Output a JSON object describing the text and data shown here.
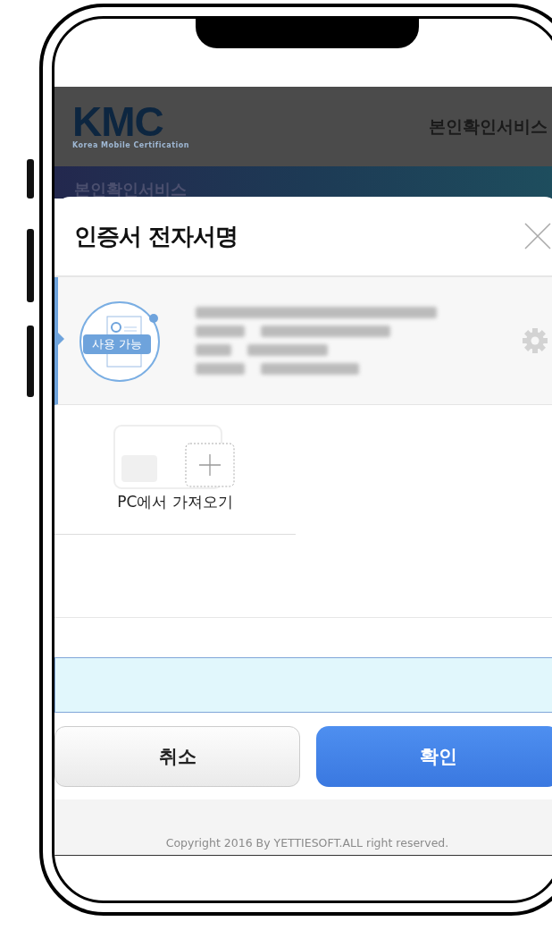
{
  "header": {
    "logo": "KMC",
    "logo_tagline": "Korea Mobile Certification",
    "service_title": "본인확인서비스"
  },
  "banner": {
    "title": "본인확인서비스"
  },
  "dialog": {
    "title": "인증서 전자서명",
    "certificates": [
      {
        "badge": "사용 가능",
        "selected": true
      }
    ],
    "import": {
      "label": "PC에서 가져오기"
    },
    "buttons": [
      {
        "label": "취소",
        "kind": "secondary"
      },
      {
        "label": "확인",
        "kind": "primary"
      }
    ]
  },
  "footer": {
    "copyright": "Copyright 2016 By YETTIESOFT.ALL right reserved."
  }
}
